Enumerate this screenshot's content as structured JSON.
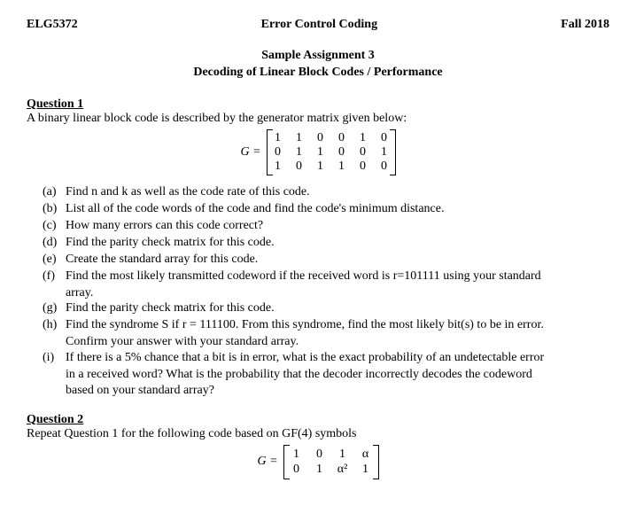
{
  "header": {
    "left": "ELG5372",
    "center": "Error Control Coding",
    "right": "Fall 2018"
  },
  "title": {
    "line1": "Sample Assignment 3",
    "line2": "Decoding of Linear Block Codes / Performance"
  },
  "q1": {
    "heading": "Question 1",
    "intro": "A binary linear block code is described by the generator matrix given below:",
    "matrix_label": "G =",
    "matrix": [
      [
        "1",
        "1",
        "0",
        "0",
        "1",
        "0"
      ],
      [
        "0",
        "1",
        "1",
        "0",
        "0",
        "1"
      ],
      [
        "1",
        "0",
        "1",
        "1",
        "0",
        "0"
      ]
    ],
    "parts": {
      "a": {
        "label": "(a)",
        "text": "Find n and k as well as the code rate of this code."
      },
      "b": {
        "label": "(b)",
        "text": "List all of the code words of the code and find the code's minimum distance."
      },
      "c": {
        "label": "(c)",
        "text": "How many errors can this code correct?"
      },
      "d": {
        "label": "(d)",
        "text": "Find the parity check matrix for this code."
      },
      "e": {
        "label": "(e)",
        "text": "Create the standard array for this code."
      },
      "f": {
        "label": "(f)",
        "text": "Find the most likely transmitted codeword if the received word is r=101111 using your standard",
        "cont": "array."
      },
      "g": {
        "label": "(g)",
        "text": "Find the parity check matrix for this code."
      },
      "h": {
        "label": "(h)",
        "text": "Find the syndrome S if r = 111100.  From this syndrome, find the most likely bit(s) to be in error.",
        "cont": "Confirm your answer with your standard array."
      },
      "i": {
        "label": "(i)",
        "text": "If there is a 5% chance that a bit is in error, what is the exact probability of an undetectable error",
        "cont": "in a received word?  What is the probability that the decoder incorrectly decodes the codeword",
        "cont2": "based on your standard array?"
      }
    }
  },
  "q2": {
    "heading": "Question 2",
    "intro": "Repeat Question 1 for the following code based on GF(4) symbols",
    "matrix_label": "G =",
    "matrix_row1": [
      "1",
      "0",
      "1",
      "α"
    ],
    "matrix_row2": [
      "0",
      "1",
      "α²",
      "1"
    ]
  }
}
